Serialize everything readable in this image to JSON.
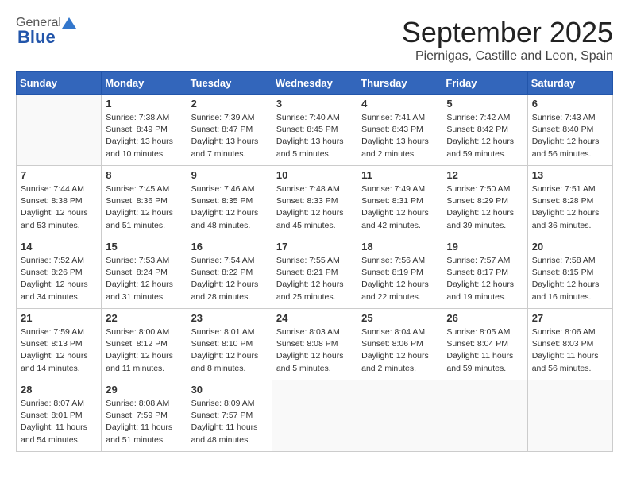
{
  "header": {
    "logo_general": "General",
    "logo_blue": "Blue",
    "month_title": "September 2025",
    "location": "Piernigas, Castille and Leon, Spain"
  },
  "days_of_week": [
    "Sunday",
    "Monday",
    "Tuesday",
    "Wednesday",
    "Thursday",
    "Friday",
    "Saturday"
  ],
  "weeks": [
    [
      {
        "day": "",
        "info": ""
      },
      {
        "day": "1",
        "info": "Sunrise: 7:38 AM\nSunset: 8:49 PM\nDaylight: 13 hours\nand 10 minutes."
      },
      {
        "day": "2",
        "info": "Sunrise: 7:39 AM\nSunset: 8:47 PM\nDaylight: 13 hours\nand 7 minutes."
      },
      {
        "day": "3",
        "info": "Sunrise: 7:40 AM\nSunset: 8:45 PM\nDaylight: 13 hours\nand 5 minutes."
      },
      {
        "day": "4",
        "info": "Sunrise: 7:41 AM\nSunset: 8:43 PM\nDaylight: 13 hours\nand 2 minutes."
      },
      {
        "day": "5",
        "info": "Sunrise: 7:42 AM\nSunset: 8:42 PM\nDaylight: 12 hours\nand 59 minutes."
      },
      {
        "day": "6",
        "info": "Sunrise: 7:43 AM\nSunset: 8:40 PM\nDaylight: 12 hours\nand 56 minutes."
      }
    ],
    [
      {
        "day": "7",
        "info": "Sunrise: 7:44 AM\nSunset: 8:38 PM\nDaylight: 12 hours\nand 53 minutes."
      },
      {
        "day": "8",
        "info": "Sunrise: 7:45 AM\nSunset: 8:36 PM\nDaylight: 12 hours\nand 51 minutes."
      },
      {
        "day": "9",
        "info": "Sunrise: 7:46 AM\nSunset: 8:35 PM\nDaylight: 12 hours\nand 48 minutes."
      },
      {
        "day": "10",
        "info": "Sunrise: 7:48 AM\nSunset: 8:33 PM\nDaylight: 12 hours\nand 45 minutes."
      },
      {
        "day": "11",
        "info": "Sunrise: 7:49 AM\nSunset: 8:31 PM\nDaylight: 12 hours\nand 42 minutes."
      },
      {
        "day": "12",
        "info": "Sunrise: 7:50 AM\nSunset: 8:29 PM\nDaylight: 12 hours\nand 39 minutes."
      },
      {
        "day": "13",
        "info": "Sunrise: 7:51 AM\nSunset: 8:28 PM\nDaylight: 12 hours\nand 36 minutes."
      }
    ],
    [
      {
        "day": "14",
        "info": "Sunrise: 7:52 AM\nSunset: 8:26 PM\nDaylight: 12 hours\nand 34 minutes."
      },
      {
        "day": "15",
        "info": "Sunrise: 7:53 AM\nSunset: 8:24 PM\nDaylight: 12 hours\nand 31 minutes."
      },
      {
        "day": "16",
        "info": "Sunrise: 7:54 AM\nSunset: 8:22 PM\nDaylight: 12 hours\nand 28 minutes."
      },
      {
        "day": "17",
        "info": "Sunrise: 7:55 AM\nSunset: 8:21 PM\nDaylight: 12 hours\nand 25 minutes."
      },
      {
        "day": "18",
        "info": "Sunrise: 7:56 AM\nSunset: 8:19 PM\nDaylight: 12 hours\nand 22 minutes."
      },
      {
        "day": "19",
        "info": "Sunrise: 7:57 AM\nSunset: 8:17 PM\nDaylight: 12 hours\nand 19 minutes."
      },
      {
        "day": "20",
        "info": "Sunrise: 7:58 AM\nSunset: 8:15 PM\nDaylight: 12 hours\nand 16 minutes."
      }
    ],
    [
      {
        "day": "21",
        "info": "Sunrise: 7:59 AM\nSunset: 8:13 PM\nDaylight: 12 hours\nand 14 minutes."
      },
      {
        "day": "22",
        "info": "Sunrise: 8:00 AM\nSunset: 8:12 PM\nDaylight: 12 hours\nand 11 minutes."
      },
      {
        "day": "23",
        "info": "Sunrise: 8:01 AM\nSunset: 8:10 PM\nDaylight: 12 hours\nand 8 minutes."
      },
      {
        "day": "24",
        "info": "Sunrise: 8:03 AM\nSunset: 8:08 PM\nDaylight: 12 hours\nand 5 minutes."
      },
      {
        "day": "25",
        "info": "Sunrise: 8:04 AM\nSunset: 8:06 PM\nDaylight: 12 hours\nand 2 minutes."
      },
      {
        "day": "26",
        "info": "Sunrise: 8:05 AM\nSunset: 8:04 PM\nDaylight: 11 hours\nand 59 minutes."
      },
      {
        "day": "27",
        "info": "Sunrise: 8:06 AM\nSunset: 8:03 PM\nDaylight: 11 hours\nand 56 minutes."
      }
    ],
    [
      {
        "day": "28",
        "info": "Sunrise: 8:07 AM\nSunset: 8:01 PM\nDaylight: 11 hours\nand 54 minutes."
      },
      {
        "day": "29",
        "info": "Sunrise: 8:08 AM\nSunset: 7:59 PM\nDaylight: 11 hours\nand 51 minutes."
      },
      {
        "day": "30",
        "info": "Sunrise: 8:09 AM\nSunset: 7:57 PM\nDaylight: 11 hours\nand 48 minutes."
      },
      {
        "day": "",
        "info": ""
      },
      {
        "day": "",
        "info": ""
      },
      {
        "day": "",
        "info": ""
      },
      {
        "day": "",
        "info": ""
      }
    ]
  ]
}
